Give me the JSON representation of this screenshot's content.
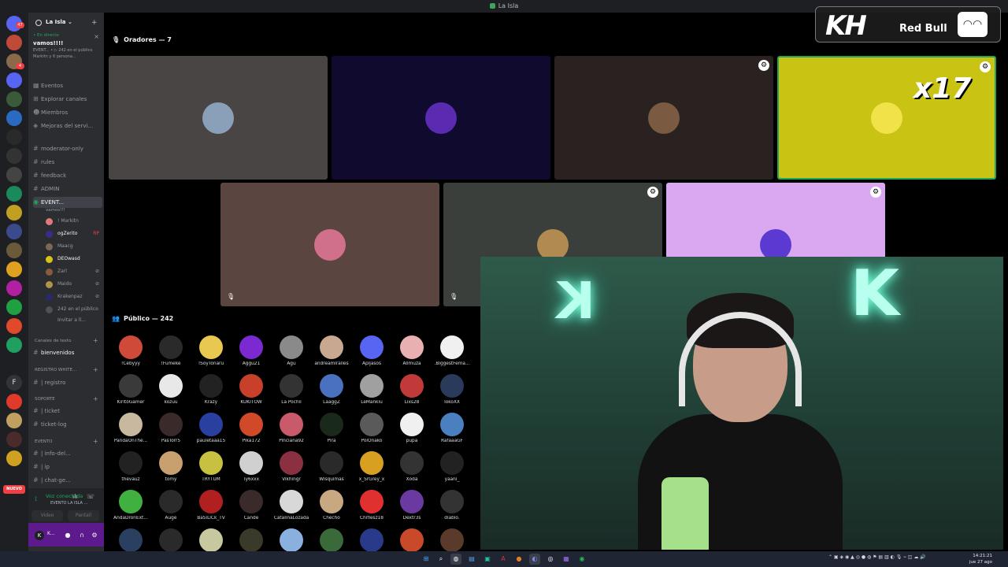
{
  "window": {
    "title": "La Isla"
  },
  "server": {
    "name": "La Isla ⌄"
  },
  "live": {
    "tag": "• En directo",
    "title": "vamos!!!!",
    "sub1": "EVENT... • ▷ 242 en el público",
    "sub2": "Markitn y 6 persona..."
  },
  "channels": [
    {
      "label": "Eventos",
      "icon": "calendar-icon"
    },
    {
      "label": "Explorar canales",
      "icon": "explore-icon"
    },
    {
      "label": "Miembros",
      "icon": "members-icon"
    },
    {
      "label": "Mejoras del servi...",
      "icon": "boost-icon"
    },
    {
      "label": "moderator-only",
      "icon": "hash-icon"
    },
    {
      "label": "rules",
      "icon": "hash-icon"
    },
    {
      "label": "feedback",
      "icon": "hash-icon"
    },
    {
      "label": "ADMIN",
      "icon": "hash-icon"
    }
  ],
  "stage_channel": {
    "label": "EVENT...",
    "sub": "vamos!!!"
  },
  "stage_users": [
    {
      "name": "! Markitn",
      "color": "#e07a7a"
    },
    {
      "name": "ogZerito",
      "color": "#3b2a8a",
      "extra": "RP"
    },
    {
      "name": "Maacg",
      "color": "#7a6a55"
    },
    {
      "name": "DEOwasd",
      "color": "#d9c21a"
    },
    {
      "name": "Zarl",
      "color": "#8a5a3a"
    },
    {
      "name": "Maido",
      "color": "#b0944a"
    },
    {
      "name": "Krakenpaz",
      "color": "#2a2a6a"
    }
  ],
  "stage_public": "242 en el público",
  "stage_invite": "Invitar a ll...",
  "categories": {
    "text": "Canales de texto",
    "registro": "REGISTRO WHITE...",
    "soporte": "SOPORTE",
    "evento": "EVENTO"
  },
  "text_channels": {
    "bienvenidos": "bienvenidos",
    "registro": "| registro",
    "ticket": "| ticket",
    "ticketlog": "ticket-log",
    "info": "| info-del...",
    "ip": "| ip",
    "chat": "| chat-ge..."
  },
  "voice": {
    "status": "Voz conectada",
    "where": "EVENTO LA ISLA ...",
    "video": "Video",
    "screen": "Pantall"
  },
  "user": {
    "initial": "K",
    "name": "K..."
  },
  "rail": {
    "badge1": "47",
    "badge2": "4",
    "f_label": "F",
    "new_label": "NUEVO"
  },
  "speakers_title": "Oradores — 7",
  "audience_title": "Público — 242",
  "speaker_tiles": [
    {
      "bg": "#4a4545",
      "avatar": "#8aa0b8",
      "option": false,
      "muted": false
    },
    {
      "bg": "#0f0a2e",
      "avatar": "#5a2ab0",
      "option": false,
      "muted": false
    },
    {
      "bg": "#2a2220",
      "avatar": "#7a5a40",
      "option": true,
      "muted": false
    },
    {
      "bg": "#c9c314",
      "avatar": "#f2e24a",
      "option": true,
      "muted": false
    },
    {
      "bg": "#5b4540",
      "avatar": "#d0708a",
      "option": false,
      "muted": true
    },
    {
      "bg": "#3a3f3c",
      "avatar": "#b08a50",
      "option": true,
      "muted": true
    },
    {
      "bg": "#d9a8f0",
      "avatar": "#5a3ad0",
      "option": true,
      "muted": false
    }
  ],
  "option_glyph": "⚙",
  "mute_glyph": "🎙",
  "audience": [
    [
      "!Cebyyy",
      "!Fumeke",
      "!SoyTonaru",
      "Aggu21",
      "Agu",
      "andreamiralles",
      "Apijasos",
      "Allmuza ",
      ".BiggestFema..."
    ],
    [
      "KiritoGamer",
      "kozuu",
      "Krazy",
      "KUKITOW",
      "La Pochii",
      "LaaggZ",
      "LeMankiu",
      "Lixs28",
      "lokoXX"
    ],
    [
      "PandaOnThe...",
      "PasTorr5",
      "pauletaaa15",
      "Pika172",
      "Pinciana92",
      "Pira",
      "PoiOnako",
      "pupa",
      "RafaaaGF"
    ],
    [
      "thevauz",
      "tomy",
      "TRYTUM",
      "Ty6xxx",
      "Vikhingr",
      "Wisquimas",
      "x_SrGrey_x",
      "Xoda",
      "yaani_"
    ],
    [
      "AndaDronExt...",
      "Auge",
      "BaSiLiCk_TV",
      "Cande",
      "CatalinaLozada",
      "Checho",
      "Chiflesz18",
      "Dextr3s",
      "diablo."
    ],
    [
      "",
      "",
      "",
      "",
      "",
      "",
      "",
      "",
      ""
    ]
  ],
  "audience_colors": [
    [
      "#d04a3a",
      "#2a2a2a",
      "#e8c850",
      "#7a2ad0",
      "#8a8a8a",
      "#c8a890",
      "#5865f2",
      "#e8b0b0",
      "#f0f0f0"
    ],
    [
      "#3a3a3a",
      "#e8e8e8",
      "#222222",
      "#c8402a",
      "#333333",
      "#4a70c0",
      "#a0a0a0",
      "#c03a3a",
      "#2a3a5a"
    ],
    [
      "#c8b8a0",
      "#3a2a2a",
      "#2a40a0",
      "#d04a2a",
      "#c85a6a",
      "#1a2a1a",
      "#5a5a5a",
      "#f0f0f0",
      "#4a80c0"
    ],
    [
      "#222222",
      "#c8a070",
      "#c8c040",
      "#d0d0d0",
      "#8a3040",
      "#2a2a2a",
      "#d8a020",
      "#333333",
      "#222222"
    ],
    [
      "#40b040",
      "#2a2a2a",
      "#b02020",
      "#3a2a2a",
      "#d8d8d8",
      "#c8a880",
      "#e03030",
      "#6a3aa0",
      "#333333"
    ],
    [
      "#2a4060",
      "#2a2a2a",
      "#c8c8a0",
      "#3a3a2a",
      "#8ab0e0",
      "#3a6a3a",
      "#2a3a8a",
      "#c84a2a",
      "#5a3a2a"
    ]
  ],
  "sponsor": {
    "kh": "KH",
    "redbull": "Red Bull",
    "visor": "◠◠"
  },
  "overlay_count": "x17",
  "cam_letters": {
    "left": "K",
    "right": "K"
  },
  "taskbar": {
    "time": "14:21:21",
    "date": "jue 27 ago"
  }
}
